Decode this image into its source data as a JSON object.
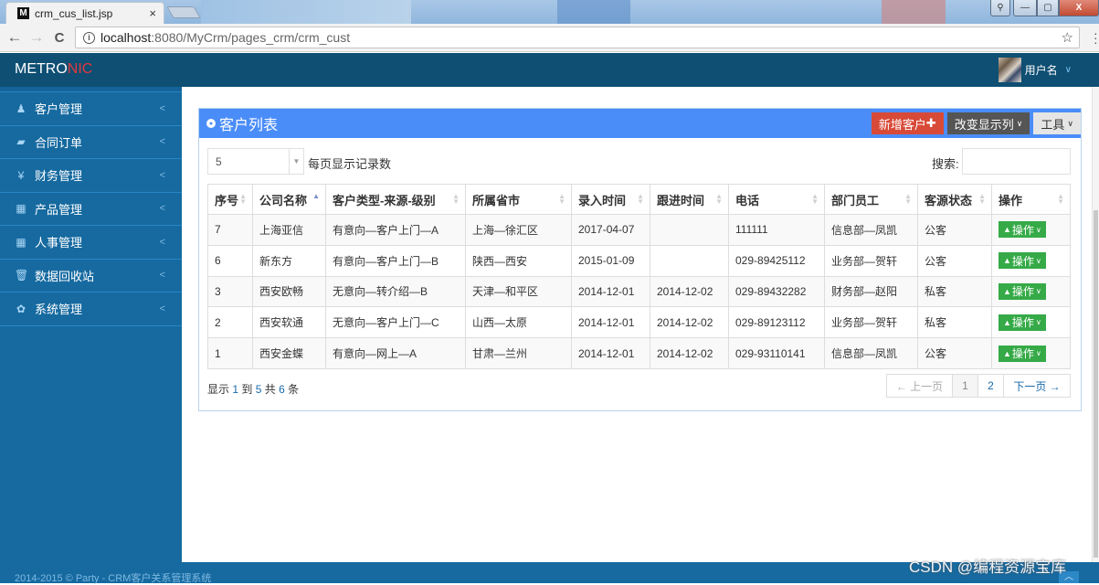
{
  "browser": {
    "tab_title": "crm_cus_list.jsp",
    "tab_favicon": "M",
    "tab_close": "×",
    "url_host": "localhost",
    "url_path": ":8080/MyCrm/pages_crm/crm_cust",
    "back": "←",
    "forward": "→",
    "reload": "C",
    "info": "i",
    "star": "☆",
    "menu": "⋮",
    "win_user": "👤",
    "win_min": "—",
    "win_max": "▢",
    "win_close": "X"
  },
  "header": {
    "logo_main": "METRO",
    "logo_accent": "NIC",
    "user_name": "用户名",
    "user_chevron": "∨"
  },
  "sidebar": {
    "items": [
      {
        "label": "客户管理",
        "icon": "person-icon",
        "glyph": "🕴",
        "arrow": "<"
      },
      {
        "label": "合同订单",
        "icon": "book-icon",
        "glyph": "▰",
        "arrow": "<"
      },
      {
        "label": "财务管理",
        "icon": "yen-icon",
        "glyph": "¥",
        "arrow": "<"
      },
      {
        "label": "产品管理",
        "icon": "table-icon",
        "glyph": "▦",
        "arrow": "<"
      },
      {
        "label": "人事管理",
        "icon": "table-icon",
        "glyph": "▦",
        "arrow": "<"
      },
      {
        "label": "数据回收站",
        "icon": "trash-icon",
        "glyph": "🗑",
        "arrow": "<"
      },
      {
        "label": "系统管理",
        "icon": "gear-icon",
        "glyph": "✿",
        "arrow": "<"
      }
    ]
  },
  "portlet": {
    "caption": "客户列表",
    "add_button": "新增客户",
    "add_icon": "✚",
    "columns_button": "改变显示列",
    "tools_button": "工具",
    "caret": "∨"
  },
  "table_controls": {
    "page_length": "5",
    "page_length_label": "每页显示记录数",
    "search_label": "搜索:",
    "search_value": "",
    "search_placeholder": ""
  },
  "table": {
    "headers": [
      "序号",
      "公司名称",
      "客户类型-来源-级别",
      "所属省市",
      "录入时间",
      "跟进时间",
      "电话",
      "部门员工",
      "客源状态",
      "操作"
    ],
    "sorted_column": "公司名称",
    "sort_direction": "asc",
    "rows": [
      [
        "7",
        "上海亚信",
        "有意向—客户上门—A",
        "上海—徐汇区",
        "2017-04-07",
        "",
        "111111",
        "信息部—凤凯",
        "公客"
      ],
      [
        "6",
        "新东方",
        "有意向—客户上门—B",
        "陕西—西安",
        "2015-01-09",
        "",
        "029-89425112",
        "业务部—贺轩",
        "公客"
      ],
      [
        "3",
        "西安欧畅",
        "无意向—转介绍—B",
        "天津—和平区",
        "2014-12-01",
        "2014-12-02",
        "029-89432282",
        "财务部—赵阳",
        "私客"
      ],
      [
        "2",
        "西安软通",
        "无意向—客户上门—C",
        "山西—太原",
        "2014-12-01",
        "2014-12-02",
        "029-89123112",
        "业务部—贺轩",
        "私客"
      ],
      [
        "1",
        "西安金蝶",
        "有意向—网上—A",
        "甘肃—兰州",
        "2014-12-01",
        "2014-12-02",
        "029-93110141",
        "信息部—凤凯",
        "公客"
      ]
    ],
    "action_label": "操作"
  },
  "info": {
    "prefix": "显示",
    "from": "1",
    "to_word": "到",
    "to": "5",
    "total_word": "共",
    "total": "6",
    "suffix": "条"
  },
  "pagination": {
    "prev": "← 上一页",
    "pages": [
      "1",
      "2"
    ],
    "current": "1",
    "next": "下一页 →"
  },
  "footer": {
    "copyright": "2014-2015 © Party - CRM客户关系管理系统",
    "to_top": "︿",
    "watermark": "CSDN @编程资源宝库"
  },
  "colors": {
    "header_bg": "#0e4f73",
    "sidebar_bg": "#166aa0",
    "portlet_title_bg": "#4b8df8",
    "add_button_bg": "#d84a38",
    "columns_button_bg": "#555555",
    "action_button_bg": "#35aa47",
    "logo_accent": "#e0383d"
  }
}
